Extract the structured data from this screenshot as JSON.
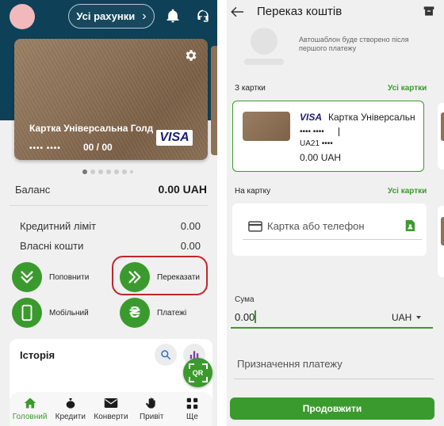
{
  "left": {
    "header": {
      "accounts_button": "Усі рахунки",
      "bg_color": "#0e4158"
    },
    "card": {
      "name": "Картка Універсальна Голд",
      "masked_number": "•••• ••••",
      "expiry": "00 / 00",
      "brand": "VISA"
    },
    "carousel": {
      "pages": 7,
      "active": 0
    },
    "balance": {
      "label": "Баланс",
      "value": "0.00 UAH"
    },
    "rows": [
      {
        "label": "Кредитний ліміт",
        "value": "0.00"
      },
      {
        "label": "Власні кошти",
        "value": "0.00"
      }
    ],
    "actions": {
      "topup": "Поповнити",
      "transfer": "Переказати",
      "mobile": "Мобільний",
      "payments": "Платежі"
    },
    "history": {
      "title": "Історія"
    },
    "qr_label": "QR",
    "nav": [
      {
        "label": "Головний",
        "icon": "home-icon",
        "active": true
      },
      {
        "label": "Кредити",
        "icon": "moneybag-icon",
        "active": false
      },
      {
        "label": "Конверти",
        "icon": "envelope-icon",
        "active": false
      },
      {
        "label": "Привіт",
        "icon": "hand-icon",
        "active": false
      },
      {
        "label": "Ще",
        "icon": "grid-icon",
        "active": false
      }
    ],
    "accent_color": "#3b9a2d",
    "highlight_color": "#c0262d"
  },
  "right": {
    "title": "Переказ коштів",
    "template_note": "Автошаблон буде створено після першого платежу",
    "from": {
      "label": "З картки",
      "all_link": "Усі картки",
      "card_brand": "VISA",
      "card_name": "Картка Універсальн",
      "masked_number": "•••• ••••",
      "iban": "UA21 ••••",
      "amount": "0.00 UAH"
    },
    "to": {
      "label": "На картку",
      "all_link": "Усі картки",
      "placeholder": "Картка або телефон"
    },
    "sum": {
      "label": "Сума",
      "value": "0.00",
      "currency": "UAH"
    },
    "purpose_placeholder": "Призначення платежу",
    "continue_button": "Продовжити"
  }
}
